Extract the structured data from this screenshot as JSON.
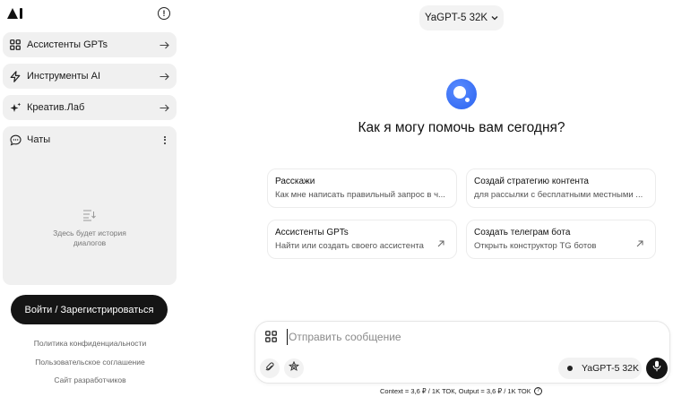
{
  "sidebar": {
    "info_glyph": "!",
    "items": [
      {
        "label": "Ассистенты GPTs",
        "icon": "grid-icon"
      },
      {
        "label": "Инструменты AI",
        "icon": "lightning-icon"
      },
      {
        "label": "Креатив.Лаб",
        "icon": "sparkles-icon"
      }
    ],
    "chats": {
      "label": "Чаты",
      "empty_text": "Здесь будет история диалогов"
    },
    "login_label": "Войти / Зарегистрироваться",
    "links": [
      "Политика конфиденциальности",
      "Пользовательское соглашение",
      "Сайт разработчиков"
    ]
  },
  "header": {
    "model_label": "YaGPT-5 32K"
  },
  "main": {
    "headline": "Как я могу помочь вам сегодня?",
    "cards": [
      {
        "title": "Расскажи",
        "subtitle": "Как мне написать правильный запрос в ч..."
      },
      {
        "title": "Создай стратегию контента",
        "subtitle": "для рассылки с бесплатными местными ..."
      },
      {
        "title": "Ассистенты GPTs",
        "subtitle": "Найти или создать своего ассистента"
      },
      {
        "title": "Создать телеграм бота",
        "subtitle": "Открыть конструктор TG ботов"
      }
    ]
  },
  "composer": {
    "placeholder": "Отправить сообщение",
    "model_label": "YaGPT-5 32K"
  },
  "footer": {
    "pricing": "Context = 3,6 ₽ / 1K ТОК, Output = 3,6 ₽ / 1K ТОК",
    "help_glyph": "?"
  },
  "colors": {
    "accent": "#2b63f0",
    "dark": "#151515",
    "panel": "#f0f0f0"
  }
}
